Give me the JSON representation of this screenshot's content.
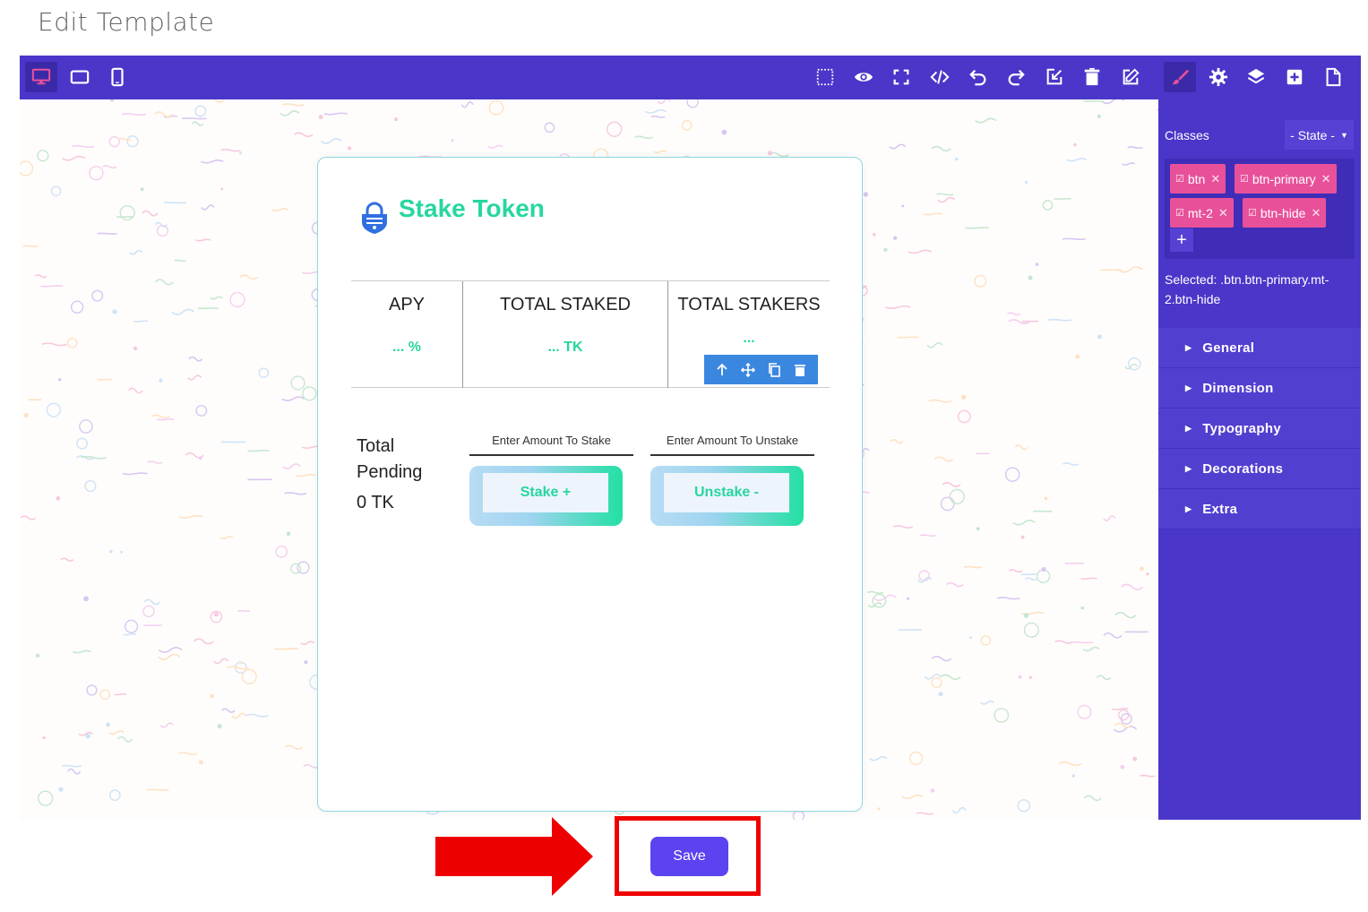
{
  "page": {
    "title": "Edit Template"
  },
  "card": {
    "title": "Stake Token",
    "stats": [
      {
        "label": "APY",
        "value": "... %"
      },
      {
        "label": "TOTAL STAKED",
        "value": "... TK"
      },
      {
        "label": "TOTAL STAKERS",
        "value": "..."
      }
    ],
    "pending_label": "Total Pending",
    "pending_value": "0 TK",
    "stake": {
      "label": "Enter Amount To Stake",
      "button": "Stake +"
    },
    "unstake": {
      "label": "Enter Amount To Unstake",
      "button": "Unstake -"
    }
  },
  "panel": {
    "classes_label": "Classes",
    "state_select": "- State -",
    "tags": [
      "btn",
      "btn-primary",
      "mt-2",
      "btn-hide"
    ],
    "add_tag": "+",
    "selected_text": "Selected: .btn.btn-primary.mt-2.btn-hide",
    "sections": [
      "General",
      "Dimension",
      "Typography",
      "Decorations",
      "Extra"
    ]
  },
  "footer": {
    "save_label": "Save"
  },
  "colors": {
    "toolbar": "#4a36c9",
    "accent_green": "#27d6a0",
    "tag_pink": "#e8519a",
    "save": "#5b43f0",
    "highlight": "#ee0000"
  }
}
